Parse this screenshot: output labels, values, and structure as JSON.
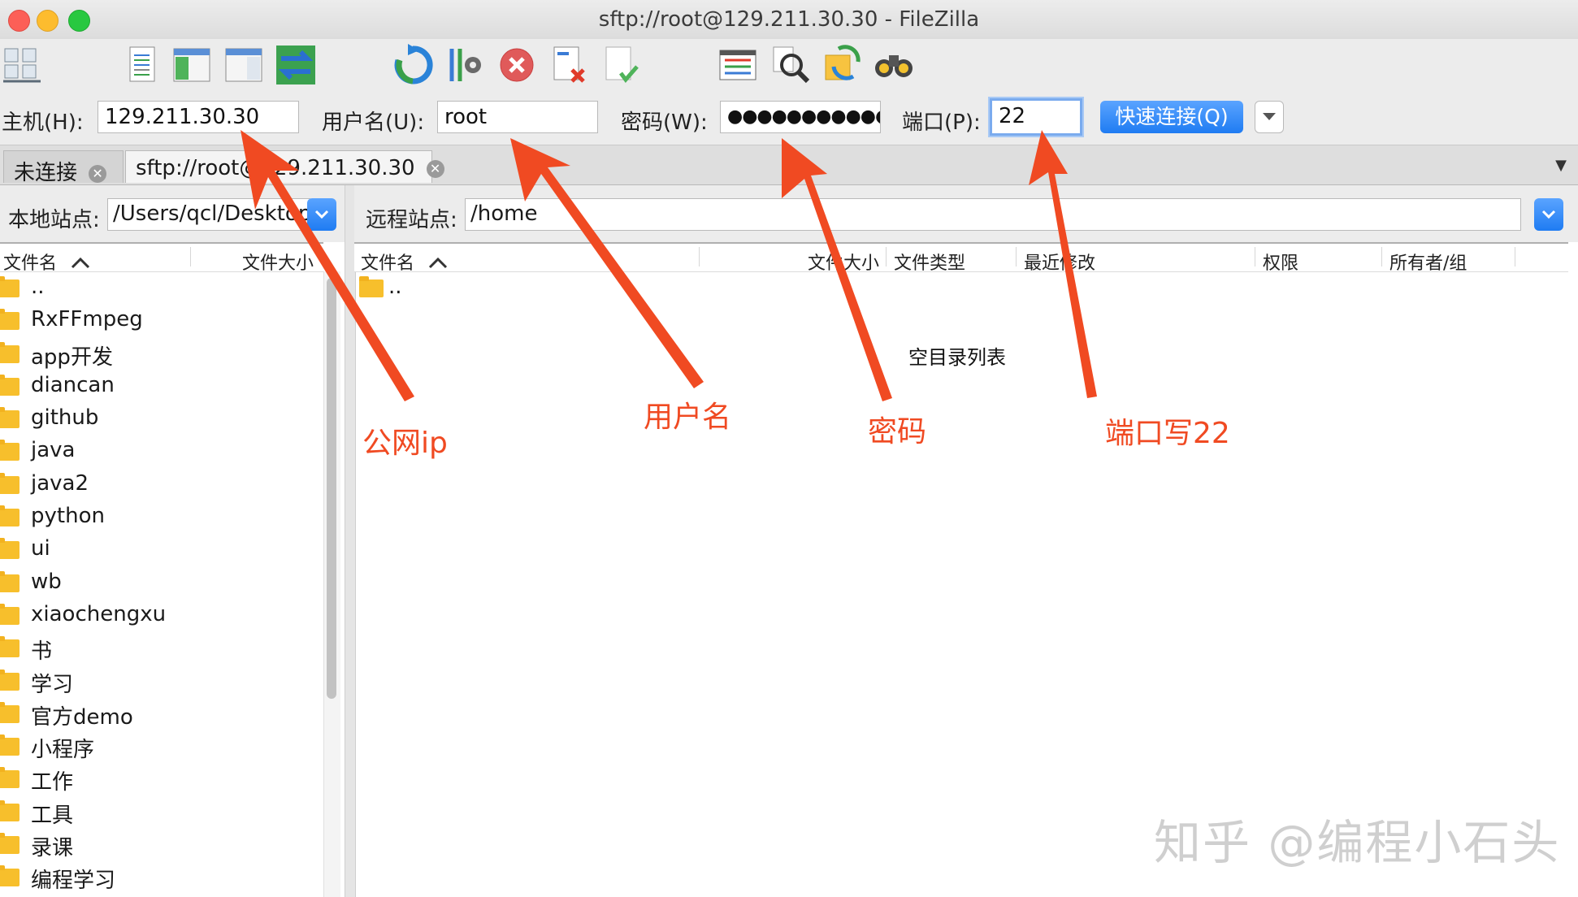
{
  "window": {
    "title": "sftp://root@129.211.30.30 - FileZilla"
  },
  "toolbar": {
    "icons": [
      "site-manager-icon",
      "message-log-icon",
      "local-tree-icon",
      "remote-tree-icon",
      "transfer-queue-icon",
      "refresh-icon",
      "process-queue-icon",
      "cancel-icon",
      "disconnect-icon",
      "reconnect-icon",
      "directory-listing-filters-icon",
      "toggle-filename-filters-icon",
      "directory-comparison-icon",
      "sync-browsing-icon",
      "search-icon"
    ]
  },
  "quickconnect": {
    "host_label": "主机(H):",
    "host_value": "129.211.30.30",
    "user_label": "用户名(U):",
    "user_value": "root",
    "password_label": "密码(W):",
    "password_value": "●●●●●●●●●●●",
    "port_label": "端口(P):",
    "port_value": "22",
    "connect_button": "快速连接(Q)"
  },
  "tabs": [
    {
      "label": "未连接",
      "active": false
    },
    {
      "label": "sftp://root@129.211.30.30",
      "active": true
    }
  ],
  "local": {
    "site_label": "本地站点:",
    "path": "/Users/qcl/Desktop",
    "columns": [
      "文件名",
      "文件大小"
    ],
    "files": [
      "..",
      "RxFFmpeg",
      "app开发",
      "diancan",
      "github",
      "java",
      "java2",
      "python",
      "ui",
      "wb",
      "xiaochengxu",
      "书",
      "学习",
      "官方demo",
      "小程序",
      "工作",
      "工具",
      "录课",
      "编程学习"
    ]
  },
  "remote": {
    "site_label": "远程站点:",
    "path": "/home",
    "columns": [
      "文件名",
      "文件大小",
      "文件类型",
      "最近修改",
      "权限",
      "所有者/组"
    ],
    "files": [
      ".."
    ],
    "empty_message": "空目录列表"
  },
  "annotations": {
    "ip": "公网ip",
    "user": "用户名",
    "password": "密码",
    "port": "端口写22",
    "color": "#f04a22"
  },
  "watermark": "知乎 @编程小石头",
  "colors": {
    "accent": "#1f7cf2",
    "folder": "#f7bf2c",
    "traffic_red": "#fc5f57",
    "traffic_yellow": "#fdbc2e",
    "traffic_green": "#28c840"
  }
}
